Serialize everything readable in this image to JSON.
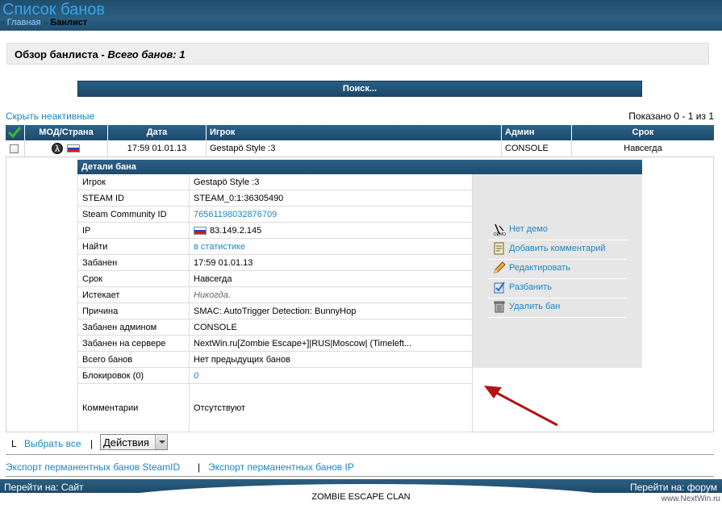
{
  "header": {
    "title": "Список банов",
    "breadcrumb": {
      "home": "Главная",
      "separator": "»",
      "current": "Банлист"
    }
  },
  "overview": {
    "title": "Обзор банлиста - ",
    "total": "Всего банов: 1"
  },
  "search": {
    "label": "Поиск..."
  },
  "hide_inactive": "Скрыть неактивные",
  "shown": "Показано 0 - 1 из 1",
  "table": {
    "headers": [
      "МОД/Страна",
      "Дата",
      "Игрок",
      "Админ",
      "Срок"
    ],
    "row": {
      "date": "17:59 01.01.13",
      "player": "Gestapö Style :3",
      "admin": "CONSOLE",
      "length": "Навсегда"
    }
  },
  "details": {
    "title": "Детали бана",
    "rows": [
      {
        "label": "Игрок",
        "value": "Gestapö Style :3"
      },
      {
        "label": "STEAM ID",
        "value": "STEAM_0:1:36305490"
      },
      {
        "label": "Steam Community ID",
        "value": "76561198032876709"
      },
      {
        "label": "IP",
        "value": "83.149.2.145"
      },
      {
        "label": "Найти",
        "value": "в статистике"
      },
      {
        "label": "Забанен",
        "value": "17:59 01.01.13"
      },
      {
        "label": "Срок",
        "value": "Навсегда"
      },
      {
        "label": "Истекает",
        "value": "Никогда."
      },
      {
        "label": "Причина",
        "value": "SMAC: AutoTrigger Detection: BunnyHop"
      },
      {
        "label": "Забанен админом",
        "value": "CONSOLE"
      },
      {
        "label": "Забанен на сервере",
        "value": "NextWin.ru[Zombie Escape+]|RUS|Moscow| (Timeleft..."
      },
      {
        "label": "Всего банов",
        "value": "Нет предыдущих банов"
      },
      {
        "label": "Блокировок (0)",
        "value": "0"
      },
      {
        "label": "Комментарии",
        "value": "Отсутствуют"
      }
    ],
    "actions": [
      {
        "label": "Нет демо",
        "icon": "demo-icon"
      },
      {
        "label": "Добавить комментарий",
        "icon": "comment-icon"
      },
      {
        "label": "Редактировать",
        "icon": "pencil-icon"
      },
      {
        "label": "Разбанить",
        "icon": "unban-icon"
      },
      {
        "label": "Удалить бан",
        "icon": "trash-icon"
      }
    ]
  },
  "bottom": {
    "prefix": "L",
    "select_all": "Выбрать все",
    "separator": "|",
    "actions_select": "Действия"
  },
  "export": {
    "steam": "Экспорт перманентных банов SteamID",
    "separator": "|",
    "ip": "Экспорт перманентных банов IP"
  },
  "footer": {
    "left": "Перейти на: Сайт",
    "right": "Перейти на: форум",
    "clan": "ZOMBIE ESCAPE CLAN",
    "watermark": "www.NextWin.ru"
  },
  "colors": {
    "accent": "#1b86c6",
    "header": "#214f70",
    "arrow": "#c01818"
  }
}
